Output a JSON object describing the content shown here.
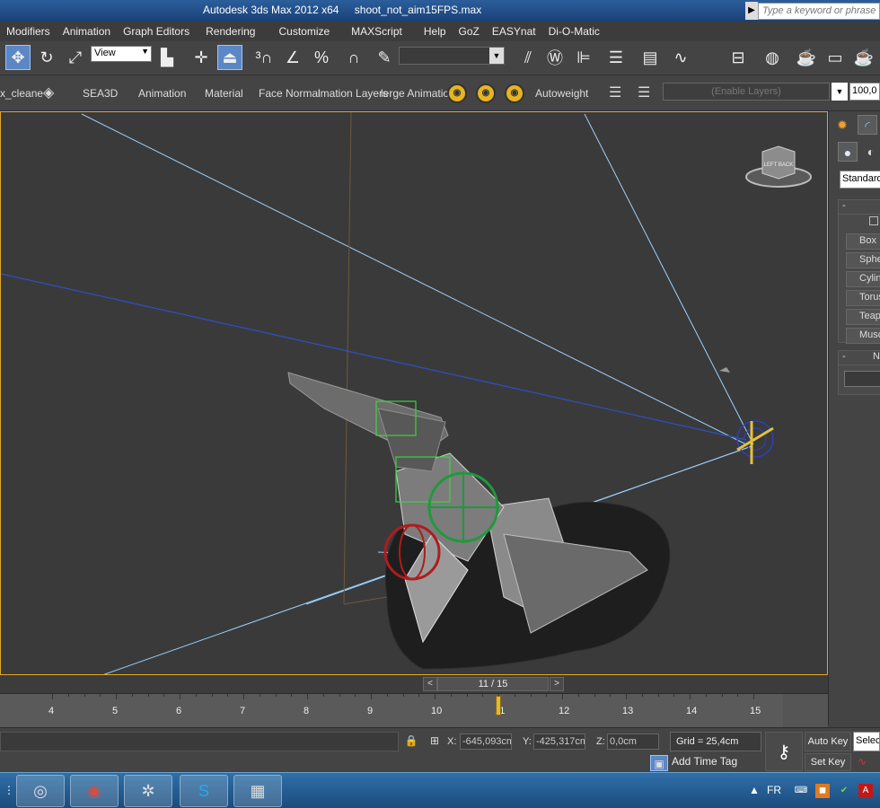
{
  "titlebar": {
    "app_title": "Autodesk 3ds Max  2012 x64",
    "file_name": "shoot_not_aim15FPS.max",
    "search_placeholder": "Type a keyword or phrase"
  },
  "menubar": {
    "items": [
      "Modifiers",
      "Animation",
      "Graph Editors",
      "Rendering",
      "Customize",
      "MAXScript",
      "Help",
      "GoZ",
      "EASYnat",
      "Di-O-Matic"
    ]
  },
  "toolbar": {
    "reference_coord": "View"
  },
  "ribbon": {
    "tabs": [
      "x_cleane",
      "SEA3D",
      "Animation",
      "Material",
      "Face Normal",
      "imation Layers",
      "lerge Animatio",
      "Autoweight"
    ],
    "layers_placeholder": "(Enable Layers)",
    "layers_value": "100,0"
  },
  "command_panel": {
    "category_dropdown": "Standard",
    "object_buttons": [
      "Box",
      "Sphere",
      "Cylinder",
      "Torus",
      "Teapot",
      "Muscle"
    ],
    "rollout2_label": "N"
  },
  "timeline": {
    "frame_display": "11 / 15",
    "prev": "<",
    "next": ">",
    "ticks": [
      "4",
      "5",
      "6",
      "7",
      "8",
      "9",
      "10",
      "11",
      "12",
      "13",
      "14",
      "15"
    ],
    "current_frame": 11
  },
  "status": {
    "x_label": "X:",
    "x_value": "-645,093cm",
    "y_label": "Y:",
    "y_value": "-425,317cm",
    "z_label": "Z:",
    "z_value": "0,0cm",
    "grid": "Grid = 25,4cm",
    "add_time_tag": "Add Time Tag",
    "auto_key": "Auto Key",
    "set_key": "Set Key",
    "selected": "Selected"
  },
  "taskbar": {
    "lang": "FR",
    "apps": [
      "3ds Max",
      "Chrome",
      "Counter-Strike",
      "Skype",
      "Image Viewer"
    ]
  },
  "colors": {
    "title_blue": "#1b4177",
    "viewport_bg": "#3a3a3a",
    "viewport_border": "#e1a629",
    "active_button": "#5b87c5"
  }
}
